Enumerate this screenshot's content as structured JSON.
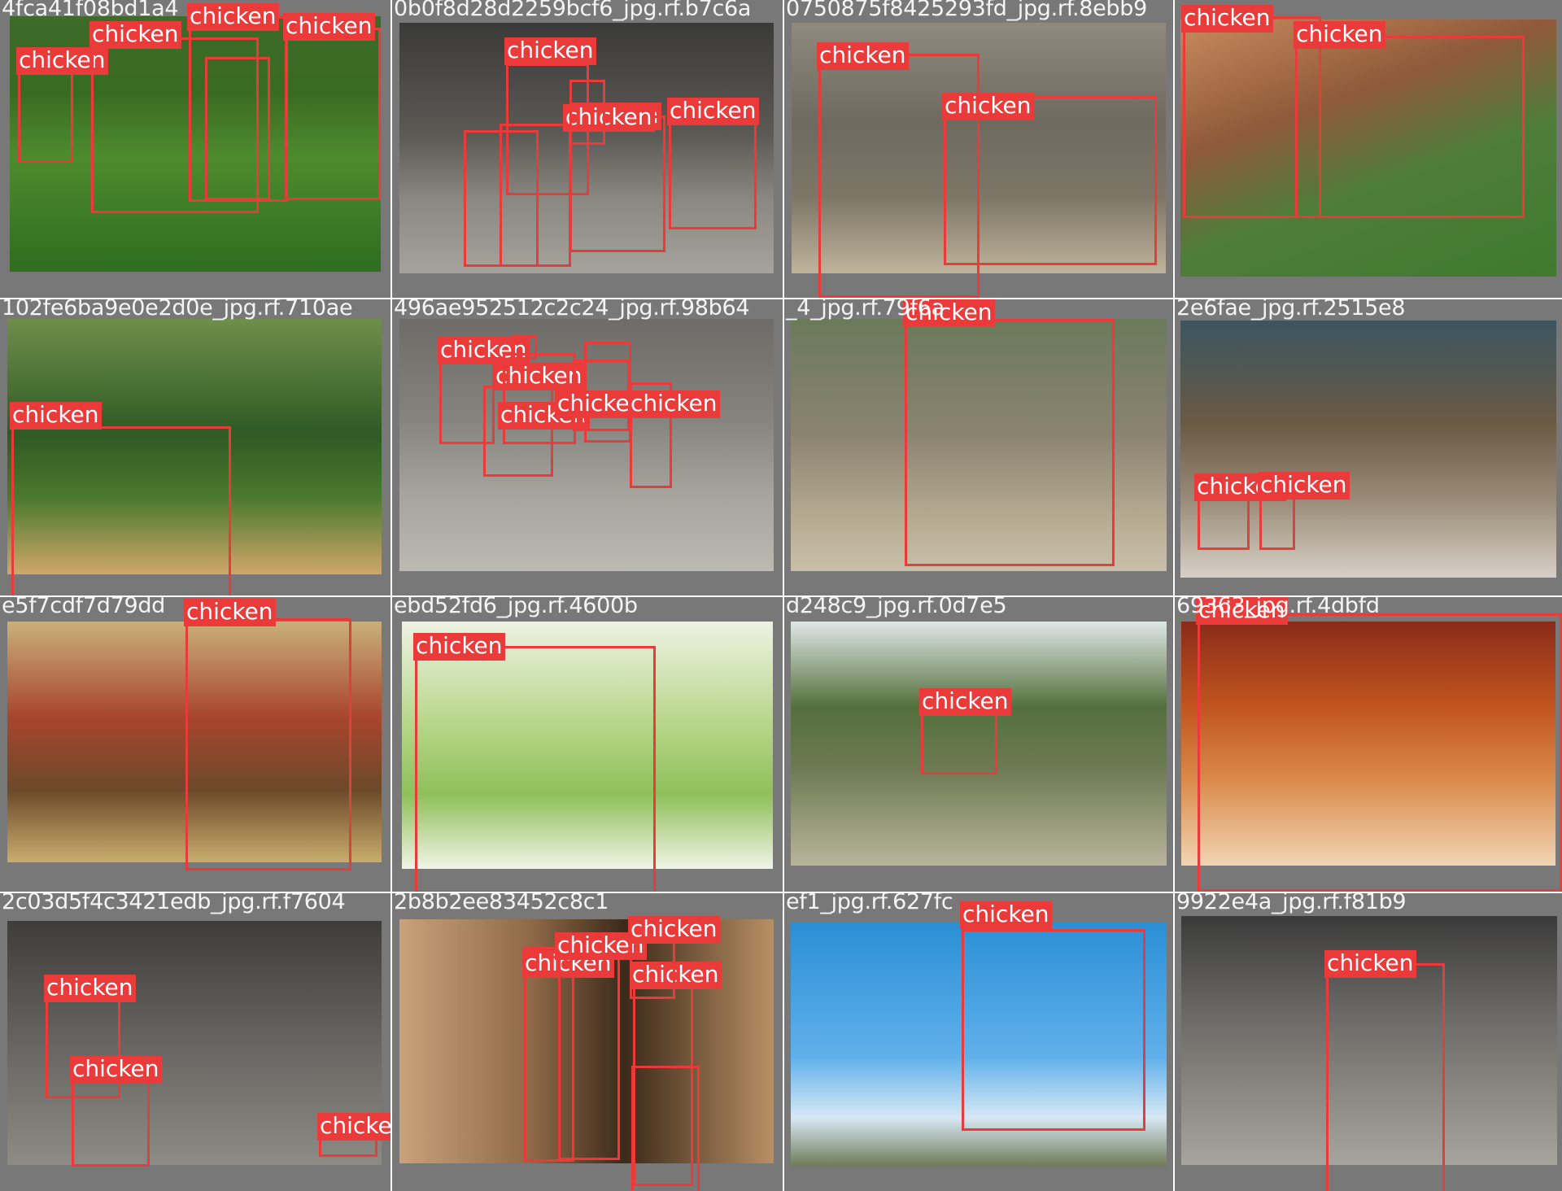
{
  "page": {
    "title": "",
    "label_text": "chicken"
  },
  "colors": {
    "box": "#ea3a3a",
    "panel": "#787878",
    "caption": "#f4f4f4"
  },
  "grid": {
    "rows": 4,
    "cols": 4
  },
  "tiles": [
    {
      "filename": "4fca41f08bd1a4",
      "boxes": 5
    },
    {
      "filename": "0b0f8d28d2259bcf6_jpg.rf.b7c6a",
      "boxes": 6
    },
    {
      "filename": "0750875f8425293fd_jpg.rf.8ebb9",
      "boxes": 2
    },
    {
      "filename": "",
      "boxes": 2
    },
    {
      "filename": "102fe6ba9e0e2d0e_jpg.rf.710ae",
      "boxes": 1
    },
    {
      "filename": "496ae952512c2c24_jpg.rf.98b64",
      "boxes": 7
    },
    {
      "filename": "_4_jpg.rf.79f6a",
      "boxes": 1
    },
    {
      "filename": "2e6fae_jpg.rf.2515e8",
      "boxes": 3
    },
    {
      "filename": "e5f7cdf7d79dd",
      "boxes": 1
    },
    {
      "filename": "ebd52fd6_jpg.rf.4600b",
      "boxes": 1
    },
    {
      "filename": "d248c9_jpg.rf.0d7e5",
      "boxes": 1
    },
    {
      "filename": "69363_jpg.rf.4dbfd",
      "boxes": 1
    },
    {
      "filename": "2c03d5f4c3421edb_jpg.rf.f7604",
      "boxes": 3
    },
    {
      "filename": "2b8b2ee83452c8c1",
      "boxes": 5
    },
    {
      "filename": "ef1_jpg.rf.627fc",
      "boxes": 1
    },
    {
      "filename": "9922e4a_jpg.rf.f81b9",
      "boxes": 1
    }
  ]
}
